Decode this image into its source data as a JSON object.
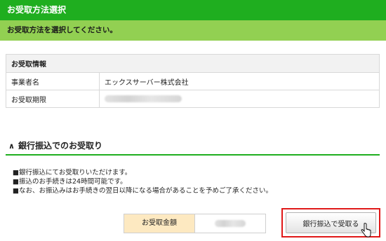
{
  "header": {
    "title": "お受取方法選択"
  },
  "subheader": {
    "text": "お受取方法を選択してください。"
  },
  "info": {
    "heading": "お受取情報",
    "rows": [
      {
        "label": "事業者名",
        "value": "エックスサーバー株式会社"
      },
      {
        "label": "お受取期限",
        "value": ""
      }
    ]
  },
  "section": {
    "title": "銀行振込でのお受取り",
    "chevron": "∧"
  },
  "notes": [
    "■銀行振込にてお受取りいただけます。",
    "■振込のお手続きは24時間可能です。",
    "■なお、お振込みはお手続きの翌日以降になる場合があることを予めご了承ください。"
  ],
  "amount": {
    "label": "お受取金額",
    "value": ""
  },
  "action": {
    "button_label": "銀行振込で受取る"
  },
  "colors": {
    "header": "#1fae1f",
    "subheader": "#92d052",
    "highlight": "#e01818",
    "amount_label_bg": "#fde9c1"
  }
}
